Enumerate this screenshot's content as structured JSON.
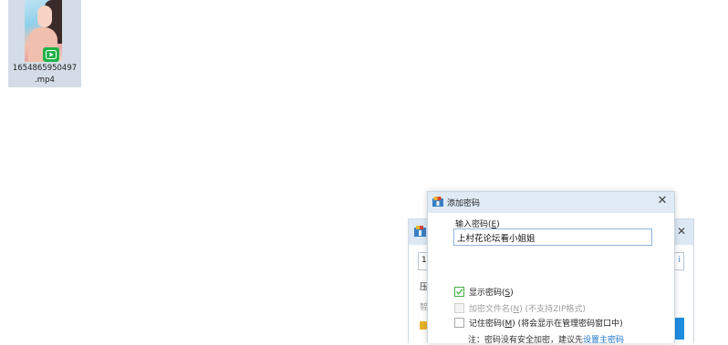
{
  "desktop": {
    "file": {
      "name_line1": "1654865950497",
      "name_line2": ".mp4"
    }
  },
  "bg_dialog": {
    "input_text": "1",
    "input_button": "i",
    "label1": "压",
    "label2": "智"
  },
  "dialog": {
    "title": "添加密码",
    "password_label": "输入密码(",
    "password_label_key": "E",
    "password_label_end": ")",
    "password_value": "上村花论坛看小姐姐",
    "options": {
      "show_password": {
        "label": "显示密码(",
        "key": "S",
        "end": ")",
        "checked": true
      },
      "encrypt_filename": {
        "label": "加密文件名(",
        "key": "N",
        "end": ")",
        "hint": " (不支持ZIP格式)",
        "enabled": false
      },
      "remember_password": {
        "label": "记住密码(",
        "key": "M",
        "end": ")",
        "hint": " (将会显示在管理密码窗口中)",
        "checked": false
      }
    },
    "note_prefix": "注：密码没有安全加密，建议先",
    "note_link": "设置主密码"
  },
  "colors": {
    "title_bar": "#dfeaf5",
    "check_green": "#3fae46",
    "link_blue": "#1a73c8",
    "video_badge": "#20b24a"
  }
}
